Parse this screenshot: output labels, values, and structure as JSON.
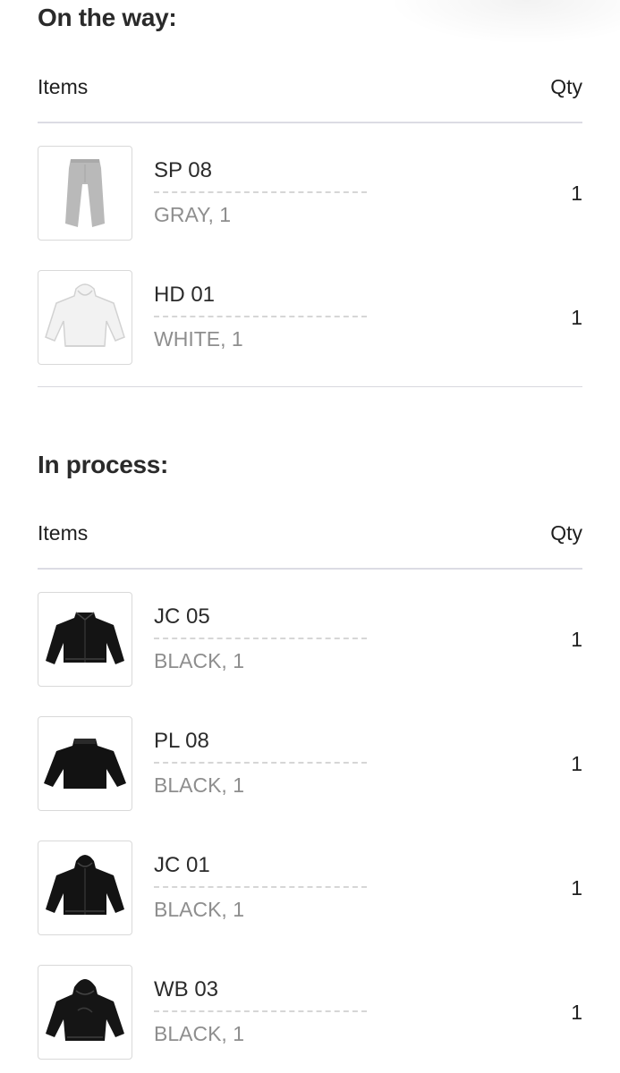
{
  "sections": [
    {
      "title": "On the way:",
      "col_items": "Items",
      "col_qty": "Qty",
      "items": [
        {
          "name": "SP 08",
          "variant": "GRAY, 1",
          "qty": "1",
          "image_icon": "gray-sweatpants-icon",
          "image_color": "#b8b8b8"
        },
        {
          "name": "HD 01",
          "variant": "WHITE, 1",
          "qty": "1",
          "image_icon": "white-hoodie-icon",
          "image_color": "#f0f0f0"
        }
      ]
    },
    {
      "title": "In process:",
      "col_items": "Items",
      "col_qty": "Qty",
      "items": [
        {
          "name": "JC 05",
          "variant": "BLACK, 1",
          "qty": "1",
          "image_icon": "black-jacket-icon",
          "image_color": "#111111"
        },
        {
          "name": "PL 08",
          "variant": "BLACK, 1",
          "qty": "1",
          "image_icon": "black-pullover-icon",
          "image_color": "#111111"
        },
        {
          "name": "JC 01",
          "variant": "BLACK, 1",
          "qty": "1",
          "image_icon": "black-hooded-jacket-icon",
          "image_color": "#111111"
        },
        {
          "name": "WB 03",
          "variant": "BLACK, 1",
          "qty": "1",
          "image_icon": "black-windbreaker-icon",
          "image_color": "#111111"
        }
      ]
    }
  ]
}
